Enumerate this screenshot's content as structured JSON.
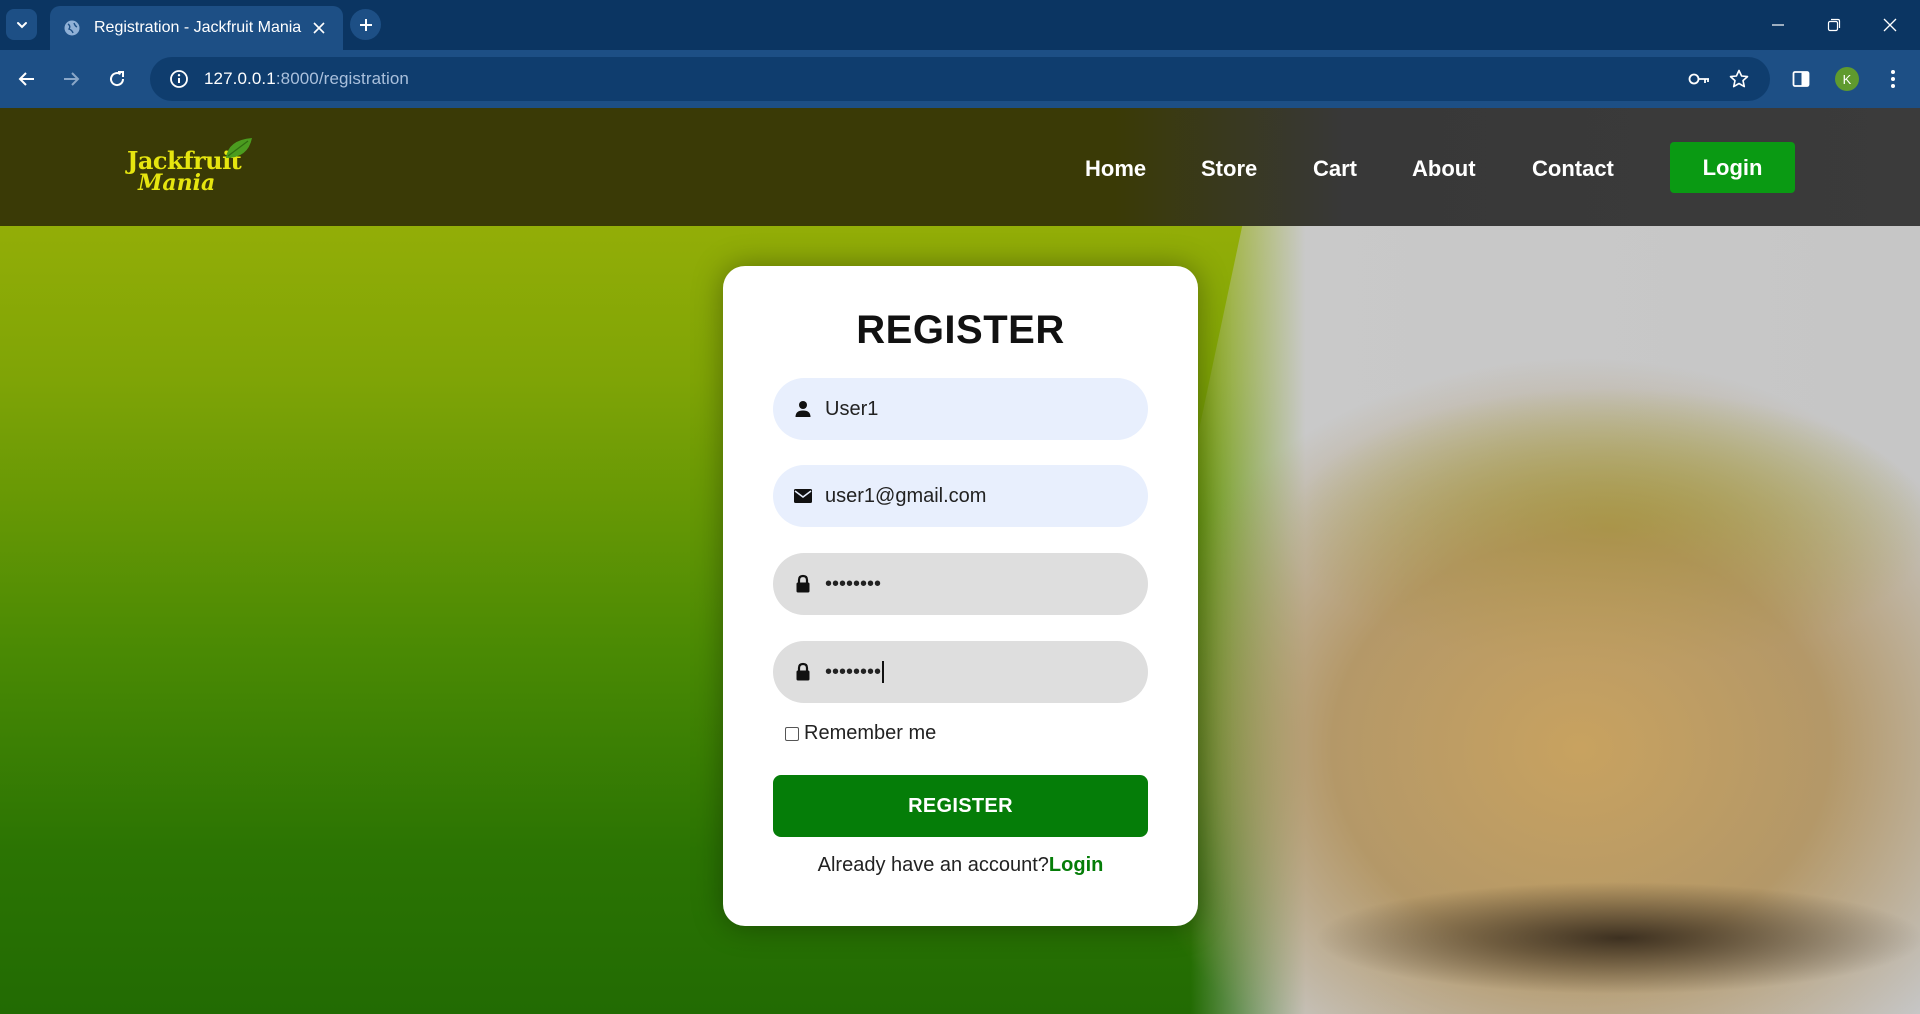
{
  "browser": {
    "tab_title": "Registration - Jackfruit Mania",
    "url_host": "127.0.0.1",
    "url_path": ":8000/registration",
    "avatar_letter": "K",
    "icons": {
      "tab_search": "chevron-down-icon",
      "tab_favicon": "globe-icon",
      "tab_close": "close-icon",
      "new_tab": "plus-icon",
      "minimize": "minimize-icon",
      "restore": "restore-icon",
      "close_window": "close-icon",
      "back": "arrow-left-icon",
      "forward": "arrow-right-icon",
      "reload": "reload-icon",
      "site_info": "info-icon",
      "password_key": "key-icon",
      "bookmark": "star-icon",
      "side_panel": "side-panel-icon",
      "menu": "more-vertical-icon"
    }
  },
  "site": {
    "logo_line1": "Jackfruit",
    "logo_line2": "Mania",
    "nav": {
      "home": "Home",
      "store": "Store",
      "cart": "Cart",
      "about": "About",
      "contact": "Contact",
      "login": "Login"
    },
    "colors": {
      "login_button": "#0a9a13",
      "register_button": "#057d08",
      "logo": "#e6e50f"
    }
  },
  "form": {
    "heading": "REGISTER",
    "username_value": "User1",
    "email_value": "user1@gmail.com",
    "password_masked": "••••••••",
    "confirm_password_masked": "••••••••",
    "remember_label": "Remember me",
    "remember_checked": false,
    "submit_label": "REGISTER",
    "already_text": "Already have an account?",
    "login_link": "Login",
    "icons": {
      "username": "user-icon",
      "email": "mail-icon",
      "password": "lock-icon",
      "confirm_password": "lock-icon"
    }
  }
}
